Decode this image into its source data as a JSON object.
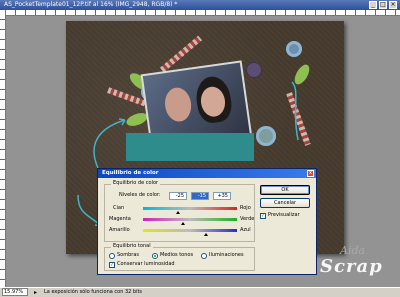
{
  "window": {
    "title": "AS_PocketTemplate01_12P.tif al 16% (IMG_2948, RGB/8) *"
  },
  "statusbar": {
    "zoom": "15.97%",
    "message": "La exposición sólo funciona con 32 bits"
  },
  "watermark": {
    "line1": "Aida",
    "line2": "Scrap"
  },
  "dialog": {
    "title": "Equilibrio de color",
    "close_glyph": "x",
    "color_balance_group": "Equilibrio de color",
    "levels_label": "Niveles de color:",
    "levels": [
      "-25",
      "-15",
      "+35"
    ],
    "sliders": [
      {
        "left": "Cian",
        "right": "Rojo",
        "value": -25,
        "colors": [
          "#00b8d8",
          "#e02020"
        ]
      },
      {
        "left": "Magenta",
        "right": "Verde",
        "value": -15,
        "colors": [
          "#d020c0",
          "#20b020"
        ]
      },
      {
        "left": "Amarillo",
        "right": "Azul",
        "value": 35,
        "colors": [
          "#e8e020",
          "#2030d0"
        ]
      }
    ],
    "tonal_group": "Equilibrio tonal",
    "tonal_options": [
      "Sombras",
      "Medios tonos",
      "Iluminaciones"
    ],
    "tonal_selected": 1,
    "preserve_luminosity": "Conservar luminosidad",
    "ok": "OK",
    "cancel": "Cancelar",
    "preview": "Previsualizar"
  },
  "colors": {
    "titlebar": "#2e4f9c",
    "dialog_title": "#0a48c4",
    "pocket": "#2e8c8c",
    "paper": "#4a3e31",
    "annotation_arrow": "#3fb5c8"
  }
}
